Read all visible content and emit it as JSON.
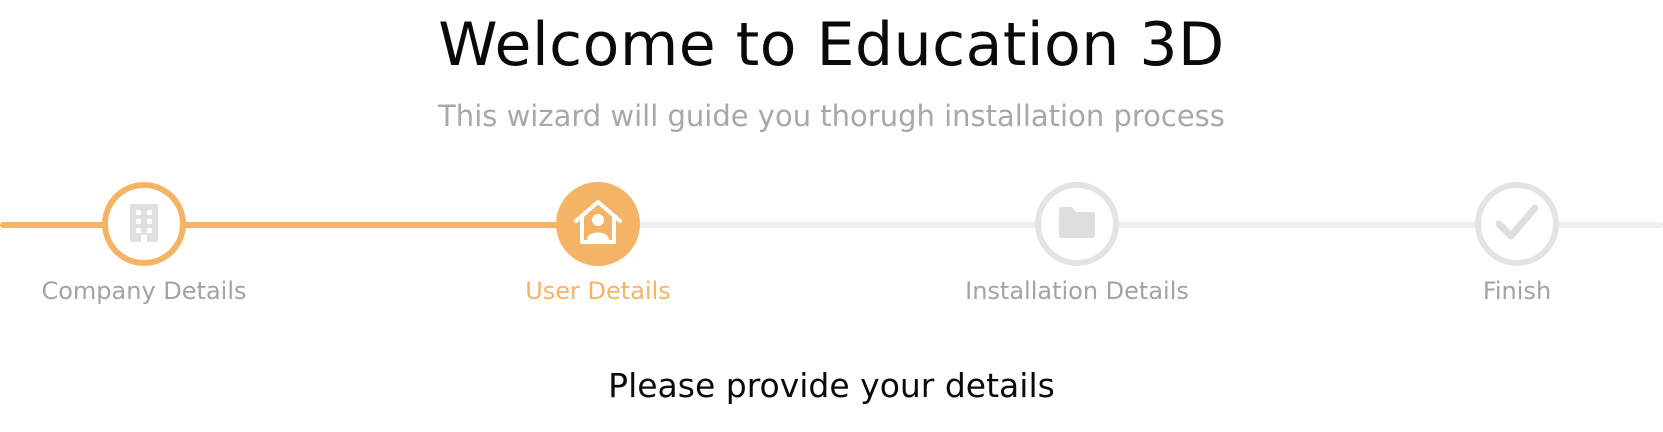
{
  "header": {
    "title": "Welcome to Education 3D",
    "subtitle": "This wizard will guide you thorugh installation process"
  },
  "wizard": {
    "accent_color": "#f5b366",
    "inactive_color": "#e3e3e3",
    "steps": [
      {
        "label": "Company Details",
        "icon": "building-icon",
        "state": "completed"
      },
      {
        "label": "User Details",
        "icon": "user-home-icon",
        "state": "active"
      },
      {
        "label": "Installation Details",
        "icon": "folder-icon",
        "state": "pending"
      },
      {
        "label": "Finish",
        "icon": "checkmark-icon",
        "state": "pending"
      }
    ]
  },
  "main": {
    "prompt": "Please provide your details"
  }
}
